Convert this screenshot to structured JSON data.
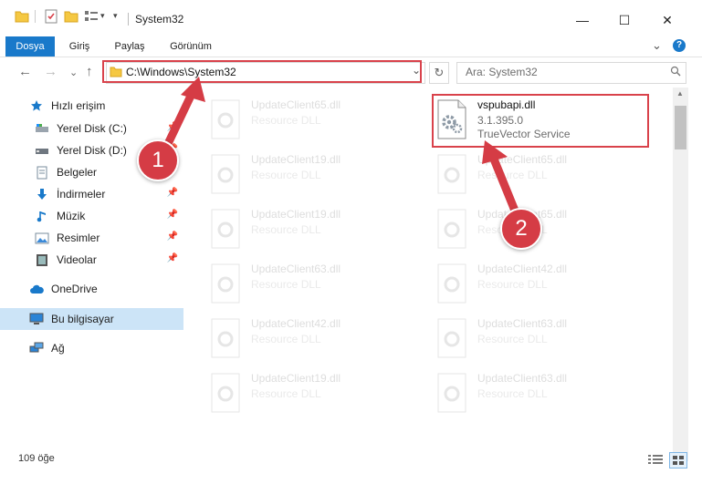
{
  "window": {
    "title": "System32",
    "minimize_glyph": "—",
    "maximize_glyph": "☐",
    "close_glyph": "✕"
  },
  "ribbon": {
    "tabs": [
      "Dosya",
      "Giriş",
      "Paylaş",
      "Görünüm"
    ],
    "active_tab": "Dosya",
    "accent_color": "#1979ca",
    "collapse_glyph": "⌄",
    "help_glyph": "?"
  },
  "address_bar": {
    "path": "C:\\Windows\\System32",
    "dropdown_glyph": "⌄",
    "refresh_glyph": "↻"
  },
  "search": {
    "placeholder": "Ara: System32"
  },
  "nav_buttons": {
    "back": "←",
    "forward": "→",
    "recent": "⌄",
    "up": "↑"
  },
  "nav_pane": {
    "quick_access": "Hızlı erişim",
    "items": [
      {
        "label": "Yerel Disk (C:)",
        "icon": "drive-icon",
        "pinned": true
      },
      {
        "label": "Yerel Disk (D:)",
        "icon": "drive-icon",
        "pinned": true
      },
      {
        "label": "Belgeler",
        "icon": "documents-icon",
        "pinned": true
      },
      {
        "label": "İndirmeler",
        "icon": "downloads-icon",
        "pinned": true
      },
      {
        "label": "Müzik",
        "icon": "music-icon",
        "pinned": true
      },
      {
        "label": "Resimler",
        "icon": "pictures-icon",
        "pinned": true
      },
      {
        "label": "Videolar",
        "icon": "videos-icon",
        "pinned": true
      }
    ],
    "onedrive": "OneDrive",
    "this_pc": "Bu bilgisayar",
    "network": "Ağ",
    "selected": "Bu bilgisayar"
  },
  "files": {
    "left_column": [
      {
        "name": "UpdateClient65.dll",
        "type": "Resource DLL"
      },
      {
        "name": "UpdateClient19.dll",
        "type": "Resource DLL"
      },
      {
        "name": "UpdateClient19.dll",
        "type": "Resource DLL"
      },
      {
        "name": "UpdateClient63.dll",
        "type": "Resource DLL"
      },
      {
        "name": "UpdateClient42.dll",
        "type": "Resource DLL"
      },
      {
        "name": "UpdateClient19.dll",
        "type": "Resource DLL"
      }
    ],
    "highlighted": {
      "name": "vspubapi.dll",
      "version": "3.1.395.0",
      "description": "TrueVector Service"
    },
    "right_column": [
      {
        "name": "UpdateClient65.dll",
        "type": "Resource DLL"
      },
      {
        "name": "UpdateClient65.dll",
        "type": "Resource DLL"
      },
      {
        "name": "UpdateClient42.dll",
        "type": "Resource DLL"
      },
      {
        "name": "UpdateClient63.dll",
        "type": "Resource DLL"
      },
      {
        "name": "UpdateClient63.dll",
        "type": "Resource DLL"
      }
    ]
  },
  "status": {
    "item_count": "109 öğe"
  },
  "callouts": {
    "first": "1",
    "second": "2",
    "color": "#d53c45"
  }
}
